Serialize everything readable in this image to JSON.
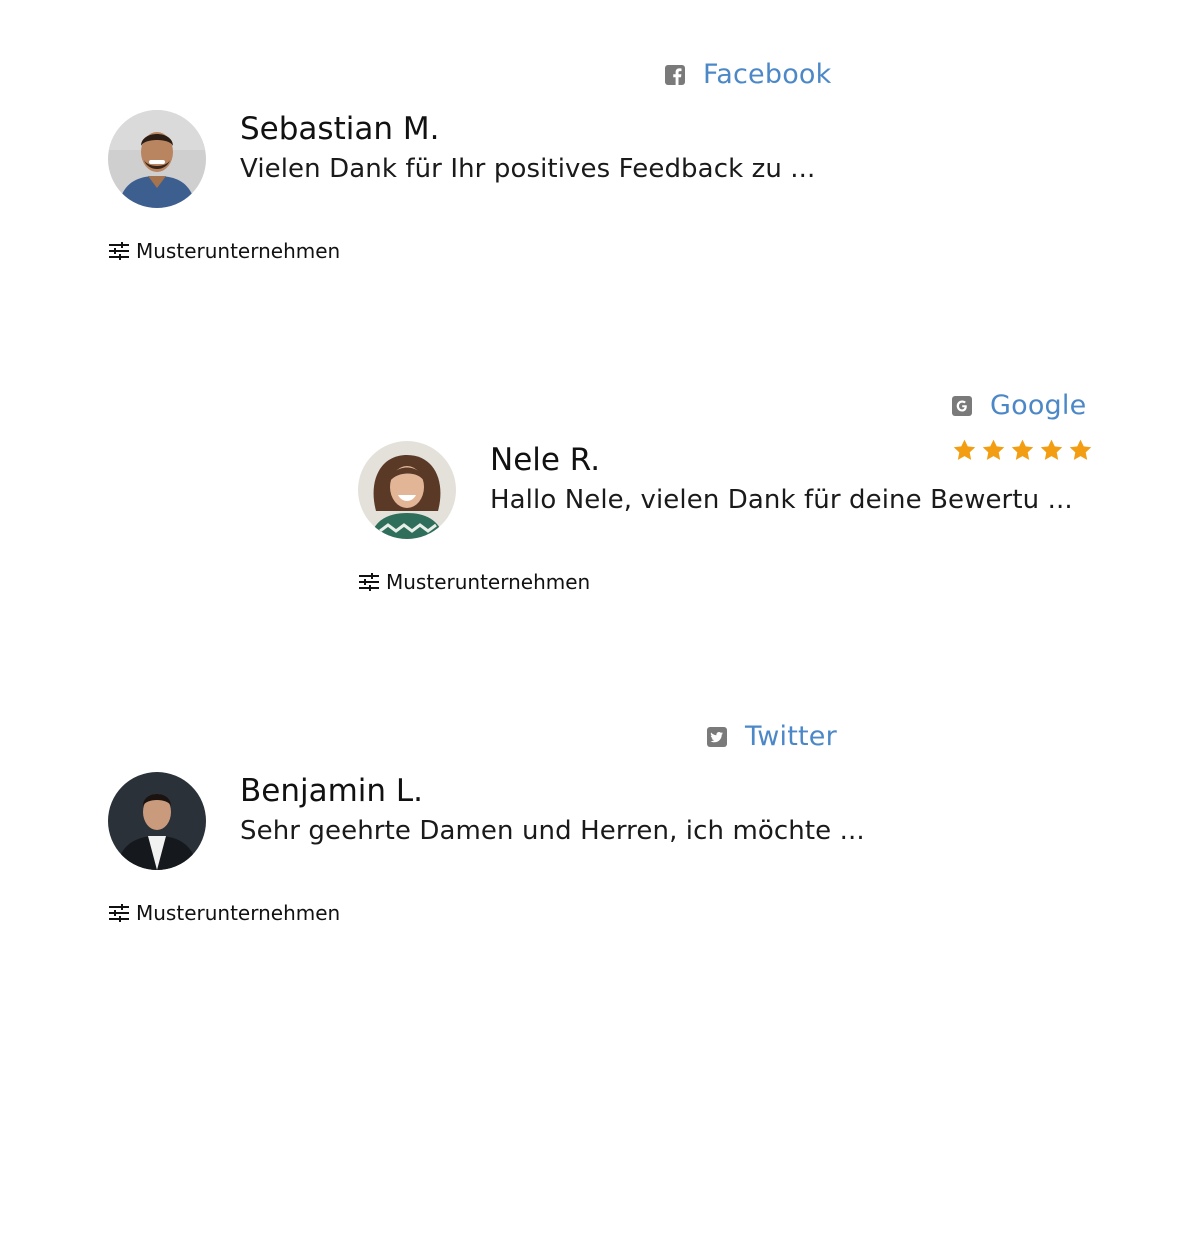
{
  "reviews": [
    {
      "source": {
        "label": "Facebook",
        "icon": "facebook-icon"
      },
      "author": "Sebastian M.",
      "message": "Vielen Dank für Ihr positives Feedback zu ...",
      "company": "Musterunternehmen",
      "rating": null
    },
    {
      "source": {
        "label": "Google",
        "icon": "google-icon"
      },
      "author": "Nele R.",
      "message": "Hallo Nele, vielen Dank für deine Bewertu ...",
      "company": "Musterunternehmen",
      "rating": 5
    },
    {
      "source": {
        "label": "Twitter",
        "icon": "twitter-icon"
      },
      "author": "Benjamin L.",
      "message": "Sehr geehrte Damen und Herren, ich möchte ...",
      "company": "Musterunternehmen",
      "rating": null
    }
  ],
  "colors": {
    "source_link": "#4c88c7",
    "source_icon": "#7a7a7a",
    "star": "#f29d12"
  }
}
